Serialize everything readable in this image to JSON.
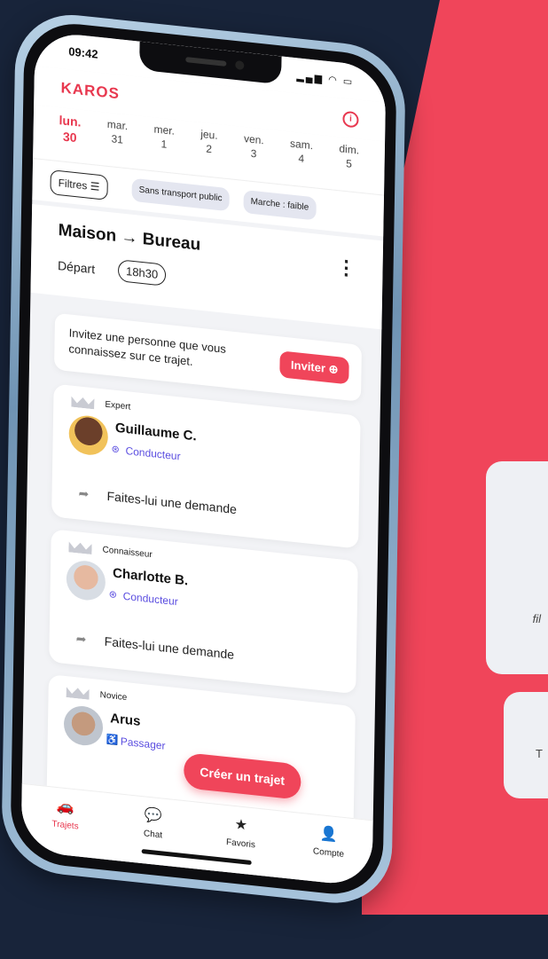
{
  "status": {
    "time": "09:42",
    "icons": "▂▄▆ ◠ ▭"
  },
  "header": {
    "brand": "KAROS",
    "info_icon": "i"
  },
  "days": [
    {
      "label": "lun.",
      "num": "30",
      "active": true
    },
    {
      "label": "mar.",
      "num": "31"
    },
    {
      "label": "mer.",
      "num": "1"
    },
    {
      "label": "jeu.",
      "num": "2"
    },
    {
      "label": "ven.",
      "num": "3"
    },
    {
      "label": "sam.",
      "num": "4"
    },
    {
      "label": "dim.",
      "num": "5"
    }
  ],
  "filters": {
    "filter_label": "Filtres ☰",
    "chip1": "Sans transport public",
    "chip2": "Marche : faible"
  },
  "trip": {
    "title": "Maison → Bureau",
    "depart_label": "Départ",
    "depart_time": "18h30",
    "more": "⋮"
  },
  "invite": {
    "text": "Invitez une personne que vous connaissez sur ce trajet.",
    "button": "Inviter ⊕"
  },
  "cards": [
    {
      "level": "Expert",
      "name": "Guillaume C.",
      "role": "Conducteur",
      "request": "Faites-lui une demande"
    },
    {
      "level": "Connaisseur",
      "name": "Charlotte B.",
      "role": "Conducteur",
      "request": "Faites-lui une demande"
    },
    {
      "level": "Novice",
      "name": "Arus",
      "role": "Passager"
    }
  ],
  "fab": "Créer un trajet",
  "tabs": [
    {
      "label": "Trajets",
      "icon": "🚗",
      "active": true
    },
    {
      "label": "Chat",
      "icon": "💬"
    },
    {
      "label": "Favoris",
      "icon": "★"
    },
    {
      "label": "Compte",
      "icon": "👤"
    }
  ],
  "background": {
    "text1": "fil",
    "text2": "T"
  },
  "colors": {
    "accent": "#f0455a",
    "role": "#5b4ee0",
    "background": "#18243a"
  }
}
